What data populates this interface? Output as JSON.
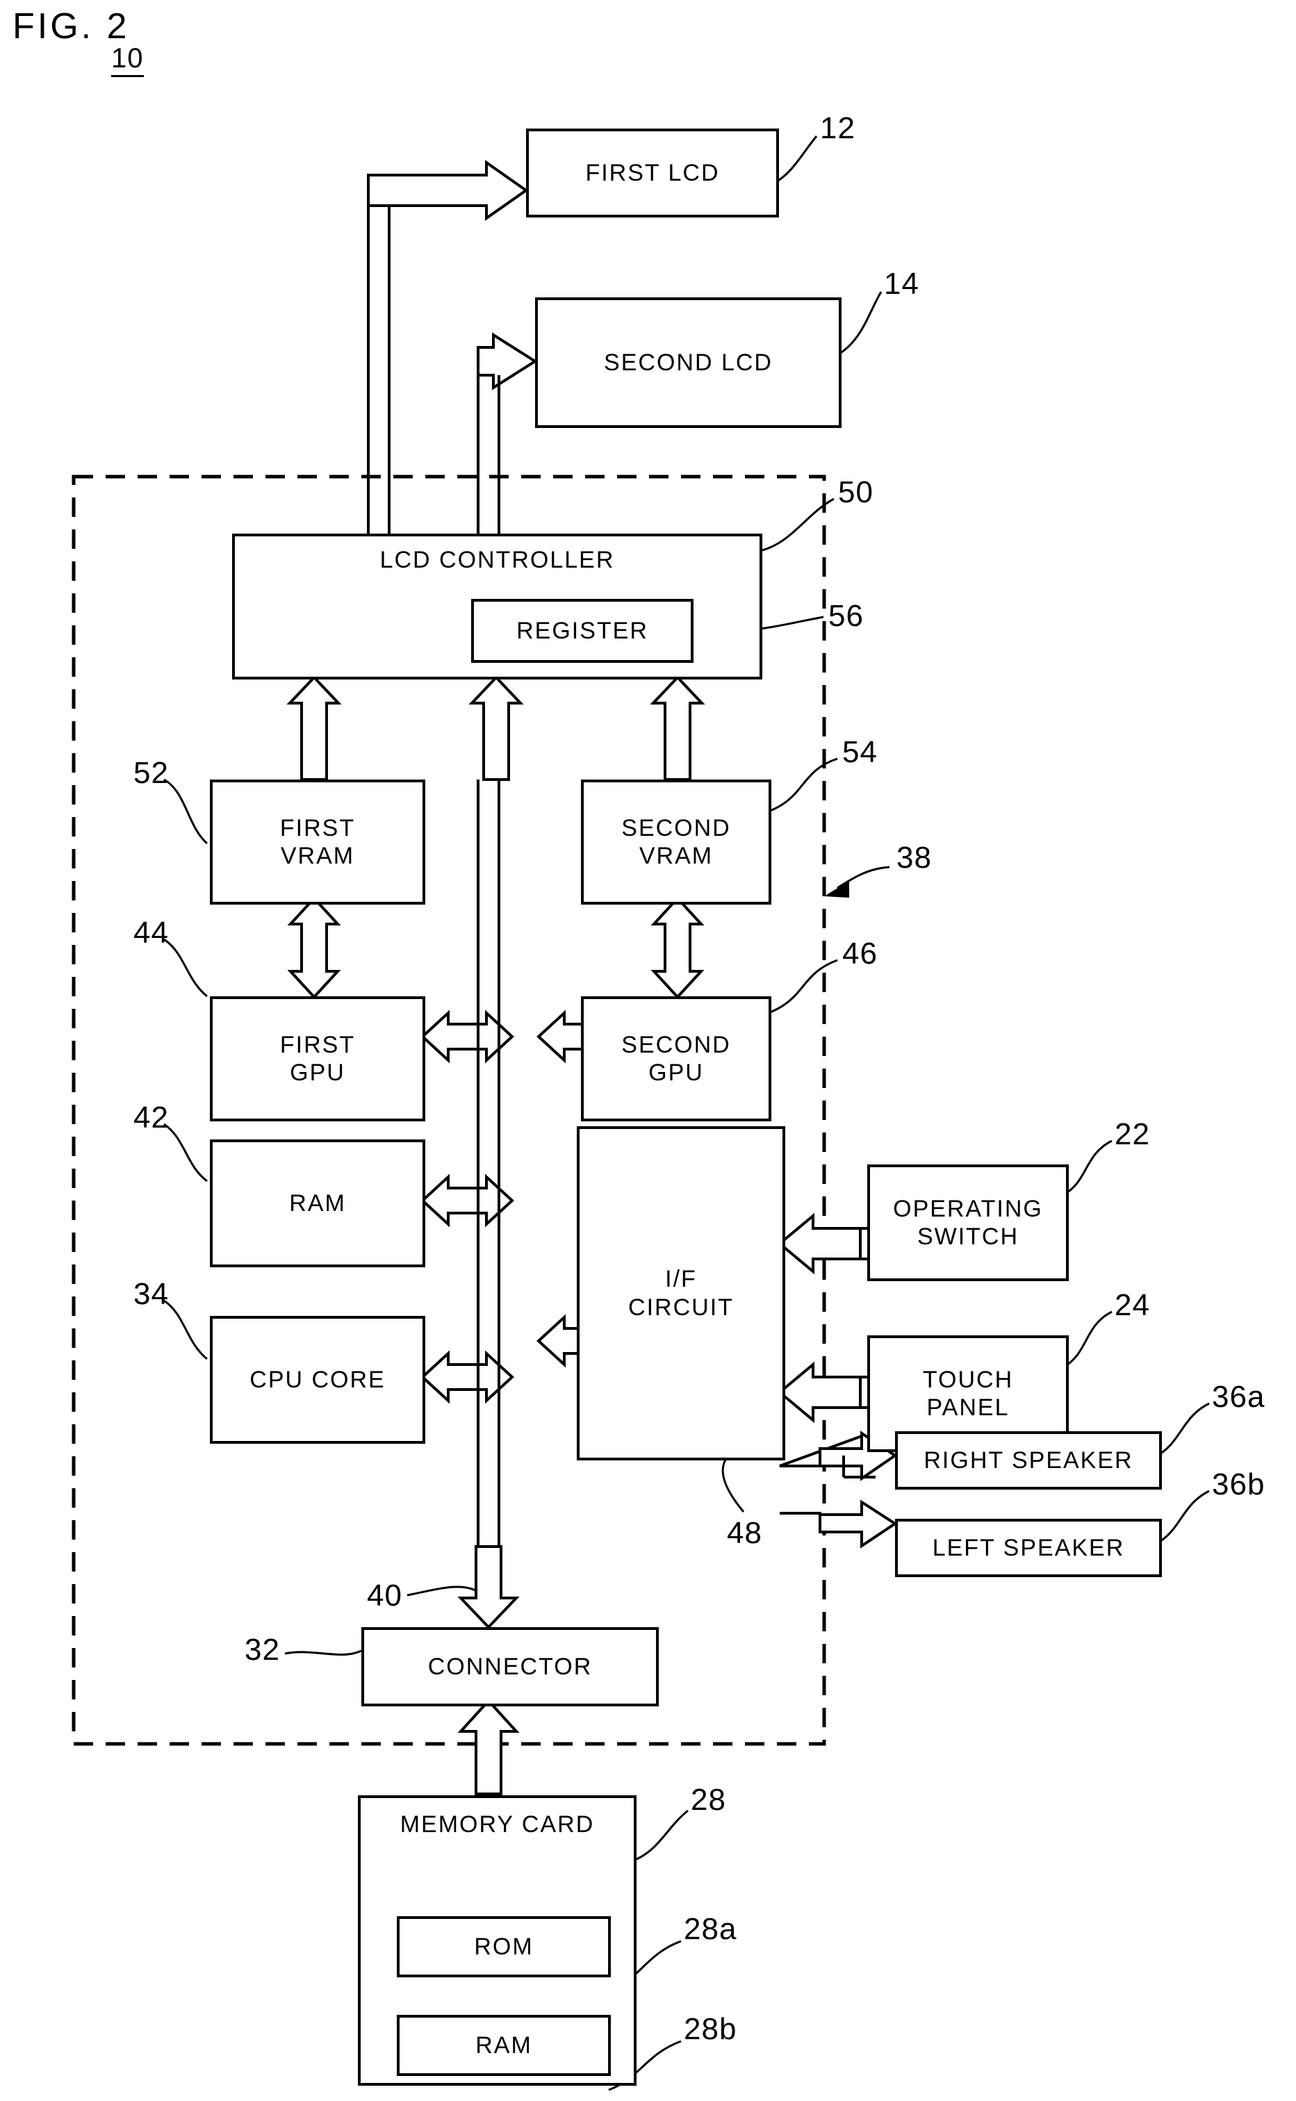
{
  "figure": {
    "title": "FIG. 2",
    "system_ref": "10"
  },
  "blocks": [
    {
      "id": "first-lcd",
      "label": "FIRST LCD",
      "ref": "12"
    },
    {
      "id": "second-lcd",
      "label": "SECOND LCD",
      "ref": "14"
    },
    {
      "id": "lcd-controller",
      "label": "LCD CONTROLLER",
      "ref": "50"
    },
    {
      "id": "register",
      "label": "REGISTER",
      "ref": "56"
    },
    {
      "id": "first-vram",
      "label": "FIRST\nVRAM",
      "ref": "52"
    },
    {
      "id": "second-vram",
      "label": "SECOND\nVRAM",
      "ref": "54"
    },
    {
      "id": "first-gpu",
      "label": "FIRST\nGPU",
      "ref": "44"
    },
    {
      "id": "second-gpu",
      "label": "SECOND\nGPU",
      "ref": "46"
    },
    {
      "id": "ram",
      "label": "RAM",
      "ref": "42"
    },
    {
      "id": "cpu-core",
      "label": "CPU CORE",
      "ref": "34"
    },
    {
      "id": "if-circuit",
      "label": "I/F\nCIRCUIT",
      "ref": "48"
    },
    {
      "id": "operating-switch",
      "label": "OPERATING\nSWITCH",
      "ref": "22"
    },
    {
      "id": "touch-panel",
      "label": "TOUCH\nPANEL",
      "ref": "24"
    },
    {
      "id": "right-speaker",
      "label": "RIGHT SPEAKER",
      "ref": "36a"
    },
    {
      "id": "left-speaker",
      "label": "LEFT SPEAKER",
      "ref": "36b"
    },
    {
      "id": "connector",
      "label": "CONNECTOR",
      "ref": "32"
    },
    {
      "id": "memory-card",
      "label": "MEMORY CARD",
      "ref": "28"
    },
    {
      "id": "card-rom",
      "label": "ROM",
      "ref": "28a"
    },
    {
      "id": "card-ram",
      "label": "RAM",
      "ref": "28b"
    }
  ],
  "labels": {
    "first_lcd": "FIRST LCD",
    "second_lcd": "SECOND LCD",
    "lcd_controller": "LCD CONTROLLER",
    "register": "REGISTER",
    "first_vram_l1": "FIRST",
    "first_vram_l2": "VRAM",
    "second_vram_l1": "SECOND",
    "second_vram_l2": "VRAM",
    "first_gpu_l1": "FIRST",
    "first_gpu_l2": "GPU",
    "second_gpu_l1": "SECOND",
    "second_gpu_l2": "GPU",
    "ram": "RAM",
    "cpu_core": "CPU CORE",
    "if_circuit_l1": "I/F",
    "if_circuit_l2": "CIRCUIT",
    "operating_switch_l1": "OPERATING",
    "operating_switch_l2": "SWITCH",
    "touch_panel_l1": "TOUCH",
    "touch_panel_l2": "PANEL",
    "right_speaker": "RIGHT SPEAKER",
    "left_speaker": "LEFT SPEAKER",
    "connector": "CONNECTOR",
    "memory_card": "MEMORY CARD",
    "card_rom": "ROM",
    "card_ram": "RAM"
  },
  "refs": {
    "sys": "10",
    "r12": "12",
    "r14": "14",
    "r50": "50",
    "r56": "56",
    "r52": "52",
    "r54": "54",
    "r38": "38",
    "r44": "44",
    "r46": "46",
    "r42": "42",
    "r34": "34",
    "r22": "22",
    "r24": "24",
    "r36a": "36a",
    "r36b": "36b",
    "r40": "40",
    "r48": "48",
    "r32": "32",
    "r28": "28",
    "r28a": "28a",
    "r28b": "28b"
  },
  "colors": {
    "ink": "#000000",
    "paper": "#ffffff"
  }
}
